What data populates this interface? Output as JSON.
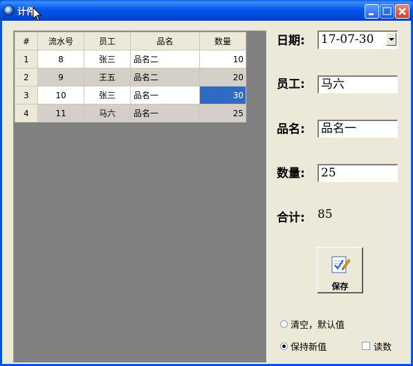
{
  "window": {
    "title": "计件"
  },
  "grid": {
    "headers": [
      "#",
      "流水号",
      "员工",
      "品名",
      "数量"
    ],
    "rows": [
      {
        "idx": "1",
        "serial": "8",
        "employee": "张三",
        "product": "品名二",
        "qty": "10"
      },
      {
        "idx": "2",
        "serial": "9",
        "employee": "王五",
        "product": "品名二",
        "qty": "20"
      },
      {
        "idx": "3",
        "serial": "10",
        "employee": "张三",
        "product": "品名一",
        "qty": "30"
      },
      {
        "idx": "4",
        "serial": "11",
        "employee": "马六",
        "product": "品名一",
        "qty": "25"
      }
    ],
    "selected_row": 2,
    "selected_col": "qty",
    "selection_color": "#316ac5"
  },
  "form": {
    "date_label": "日期:",
    "date_value": "17-07-30",
    "employee_label": "员工:",
    "employee_value": "马六",
    "product_label": "品名:",
    "product_value": "品名一",
    "qty_label": "数量:",
    "qty_value": "25",
    "total_label": "合计:",
    "total_value": "85"
  },
  "save_button": {
    "label": "保存",
    "icon": "save-notepad-icon"
  },
  "options": {
    "clear_default_label": "清空，默认值",
    "keep_new_label": "保持新值",
    "read_count_label": "读数",
    "clear_default_checked": false,
    "keep_new_checked": true,
    "read_count_checked": false
  }
}
